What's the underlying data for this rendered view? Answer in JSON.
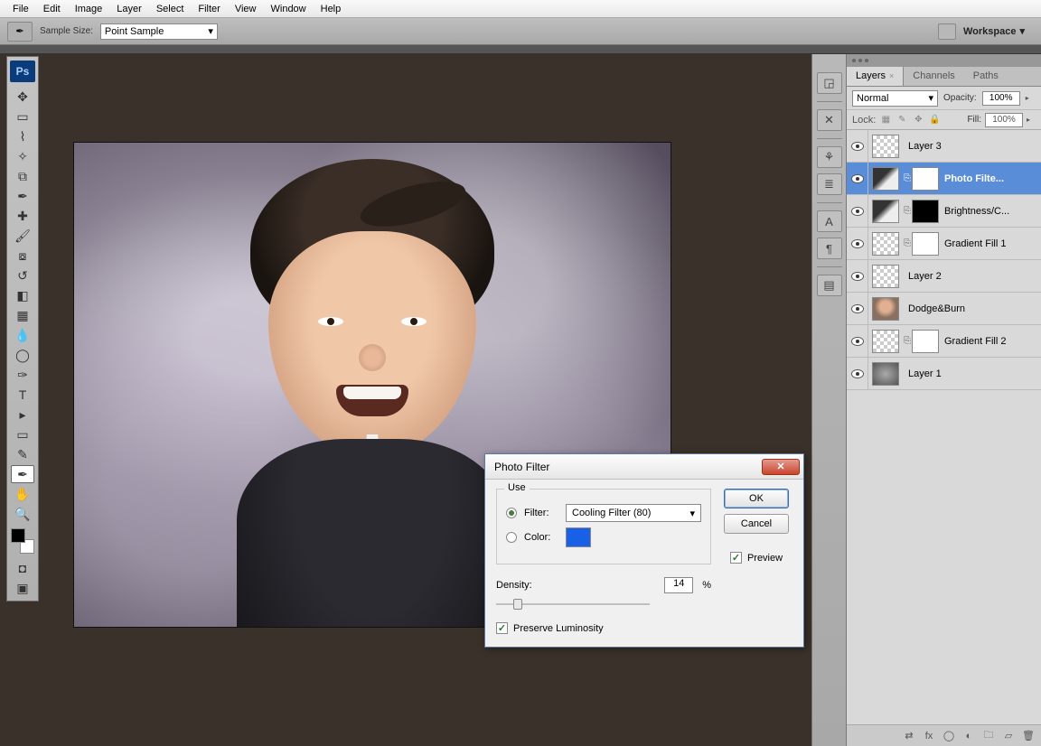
{
  "menu": [
    "File",
    "Edit",
    "Image",
    "Layer",
    "Select",
    "Filter",
    "View",
    "Window",
    "Help"
  ],
  "options": {
    "sample_label": "Sample Size:",
    "sample_value": "Point Sample",
    "workspace": "Workspace"
  },
  "ps_icon": "Ps",
  "panels": {
    "tabs": {
      "layers": "Layers",
      "channels": "Channels",
      "paths": "Paths"
    },
    "blend_mode": "Normal",
    "opacity_label": "Opacity:",
    "opacity_value": "100%",
    "lock_label": "Lock:",
    "fill_label": "Fill:",
    "fill_value": "100%"
  },
  "layers": [
    {
      "name": "Layer 3"
    },
    {
      "name": "Photo Filte..."
    },
    {
      "name": "Brightness/C..."
    },
    {
      "name": "Gradient Fill 1"
    },
    {
      "name": "Layer 2"
    },
    {
      "name": "Dodge&Burn"
    },
    {
      "name": "Gradient Fill 2"
    },
    {
      "name": "Layer 1"
    }
  ],
  "dialog": {
    "title": "Photo Filter",
    "use_legend": "Use",
    "filter_label": "Filter:",
    "filter_value": "Cooling Filter (80)",
    "color_label": "Color:",
    "color_hex": "#1860e8",
    "density_label": "Density:",
    "density_value": "14",
    "density_unit": "%",
    "preserve_label": "Preserve Luminosity",
    "ok": "OK",
    "cancel": "Cancel",
    "preview": "Preview"
  }
}
